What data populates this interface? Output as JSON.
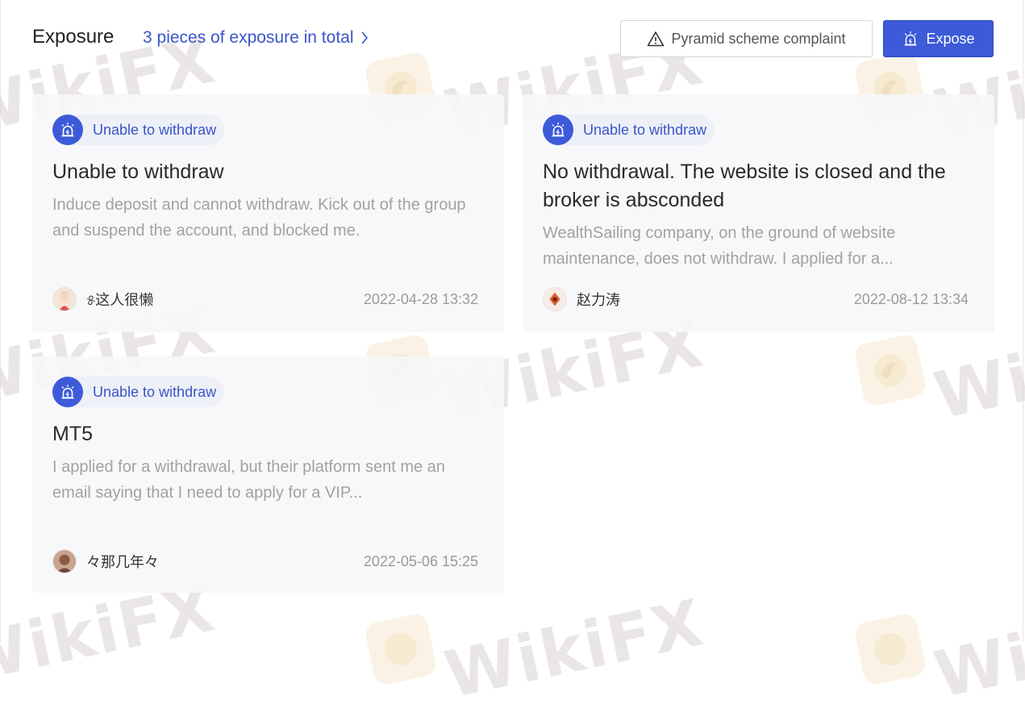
{
  "header": {
    "title": "Exposure",
    "total_link": "3 pieces of exposure in total",
    "complaint_button": "Pyramid scheme complaint",
    "expose_button": "Expose"
  },
  "watermark": {
    "text": "WikiFX"
  },
  "colors": {
    "accent": "#3d5ad8",
    "link": "#3a55c9",
    "card_bg": "#f7f7f9"
  },
  "cards": [
    {
      "badge": "Unable to withdraw",
      "title": "Unable to withdraw",
      "description": "Induce deposit and cannot withdraw. Kick out of the group and suspend the account, and blocked me.",
      "author": "୫这人很懒",
      "date": "2022-04-28 13:32"
    },
    {
      "badge": "Unable to withdraw",
      "title": "No withdrawal. The website is closed and the broker is absconded",
      "description": "WealthSailing company, on the ground of website maintenance, does not withdraw. I applied for a...",
      "author": "赵力涛",
      "date": "2022-08-12 13:34"
    },
    {
      "badge": "Unable to withdraw",
      "title": "MT5",
      "description": "I applied for a withdrawal, but their platform sent me an email saying that I need to apply for a VIP...",
      "author": "々那几年々",
      "date": "2022-05-06 15:25"
    }
  ],
  "icons": {
    "chevron": "chevron-right-icon",
    "warning": "warning-triangle-icon",
    "alarm": "alarm-light-icon"
  }
}
